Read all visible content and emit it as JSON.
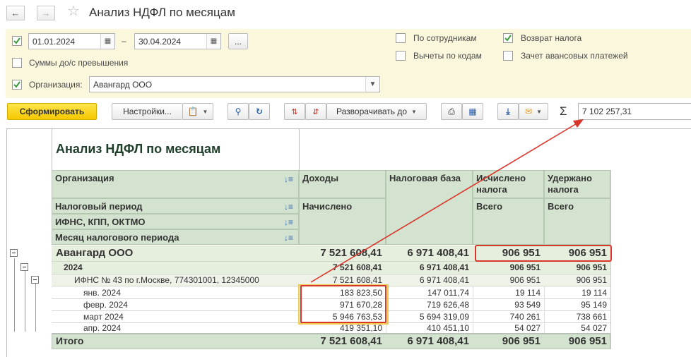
{
  "window": {
    "title": "Анализ НДФЛ по месяцам"
  },
  "filters": {
    "date_from": "01.01.2024",
    "date_to": "30.04.2024",
    "range_dash": "–",
    "more_btn": "...",
    "sums_over_limit": "Суммы до/с превышения",
    "org_label": "Организация:",
    "org_value": "Авангард ООО",
    "by_employees": "По сотрудникам",
    "deductions_by_codes": "Вычеты по кодам",
    "tax_refund": "Возврат налога",
    "advance_offset": "Зачет авансовых платежей"
  },
  "toolbar": {
    "generate": "Сформировать",
    "settings": "Настройки...",
    "expand_to": "Разворачивать до",
    "sum_value": "7 102 257,31"
  },
  "report": {
    "title": "Анализ НДФЛ по месяцам",
    "row_headers": [
      "Организация",
      "Налоговый период",
      "ИФНС, КПП, ОКТМО",
      "Месяц налогового периода"
    ],
    "col_income": "Доходы",
    "col_income_sub": "Начислено",
    "col_taxbase": "Налоговая база",
    "col_calculated": "Исчислено налога",
    "col_calculated_sub": "Всего",
    "col_withheld": "Удержано налога",
    "col_withheld_sub": "Всего",
    "rows": [
      {
        "label": "Авангард ООО",
        "income": "7 521 608,41",
        "base": "6 971 408,41",
        "calc": "906 951",
        "held": "906 951"
      },
      {
        "label": "2024",
        "income": "7 521 608,41",
        "base": "6 971 408,41",
        "calc": "906 951",
        "held": "906 951"
      },
      {
        "label": "ИФНС № 43 по г.Москве, 774301001, 12345000",
        "income": "7 521 608,41",
        "base": "6 971 408,41",
        "calc": "906 951",
        "held": "906 951"
      },
      {
        "label": "янв. 2024",
        "income": "183 823,50",
        "base": "147 011,74",
        "calc": "19 114",
        "held": "19 114"
      },
      {
        "label": "февр. 2024",
        "income": "971 670,28",
        "base": "719 626,48",
        "calc": "93 549",
        "held": "95 149"
      },
      {
        "label": "март 2024",
        "income": "5 946 763,53",
        "base": "5 694 319,09",
        "calc": "740 261",
        "held": "738 661"
      },
      {
        "label": "апр. 2024",
        "income": "419 351,10",
        "base": "410 451,10",
        "calc": "54 027",
        "held": "54 027"
      }
    ],
    "total": {
      "label": "Итого",
      "income": "7 521 608,41",
      "base": "6 971 408,41",
      "calc": "906 951",
      "held": "906 951"
    }
  },
  "colors": {
    "header_bg": "#d4e3cf",
    "primary_btn": "#f5c800",
    "filter_bg": "#fbf7dc",
    "highlight_red": "#d9362b",
    "highlight_yellow": "#f2c94c"
  }
}
